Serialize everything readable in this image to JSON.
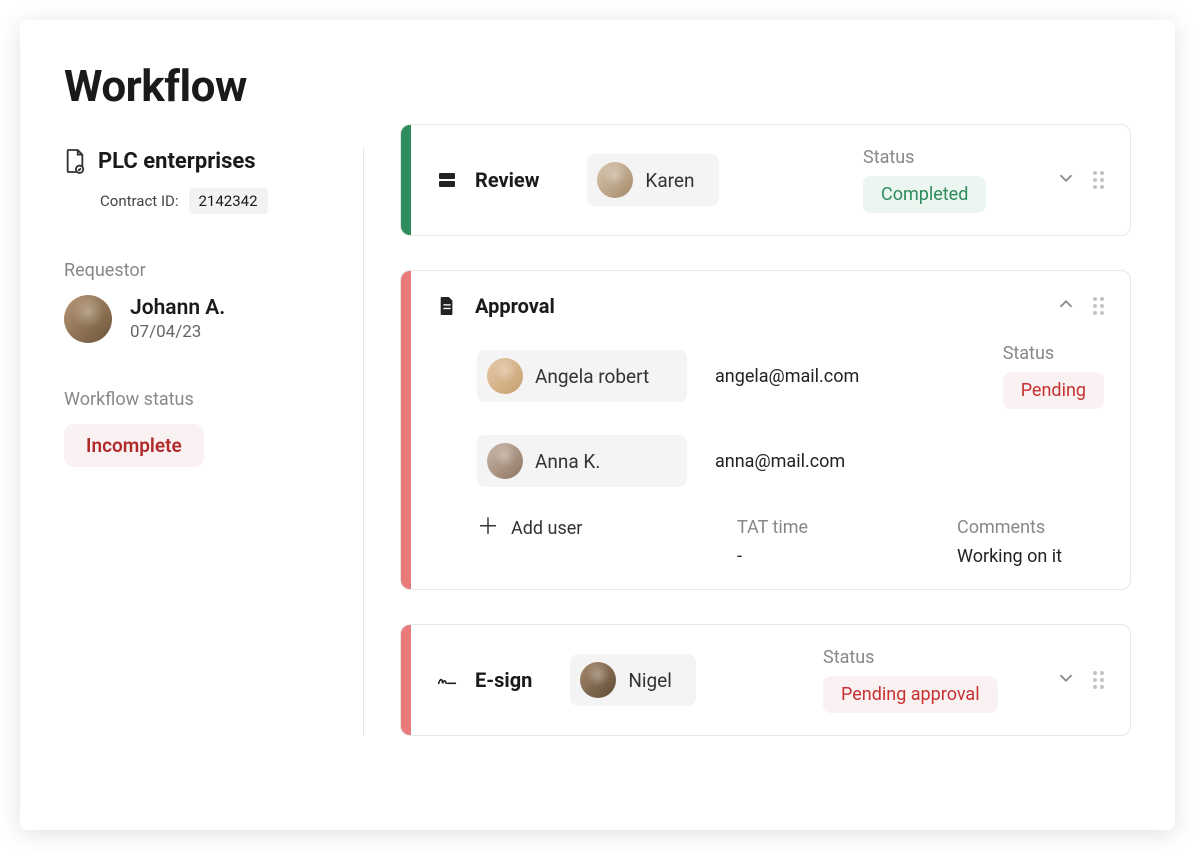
{
  "page_title": "Workflow",
  "sidebar": {
    "company_name": "PLC enterprises",
    "contract_label": "Contract ID:",
    "contract_id": "2142342",
    "requestor_label": "Requestor",
    "requestor_name": "Johann A.",
    "requestor_date": "07/04/23",
    "workflow_status_label": "Workflow status",
    "workflow_status_value": "Incomplete"
  },
  "steps": {
    "review": {
      "title": "Review",
      "user_name": "Karen",
      "status_label": "Status",
      "status_value": "Completed"
    },
    "approval": {
      "title": "Approval",
      "status_label": "Status",
      "status_value": "Pending",
      "users": [
        {
          "name": "Angela robert",
          "email": "angela@mail.com"
        },
        {
          "name": "Anna K.",
          "email": "anna@mail.com"
        }
      ],
      "add_user_label": "Add user",
      "tat_label": "TAT time",
      "tat_value": "-",
      "comments_label": "Comments",
      "comments_value": "Working on it"
    },
    "esign": {
      "title": "E-sign",
      "user_name": "Nigel",
      "status_label": "Status",
      "status_value": "Pending approval"
    }
  }
}
